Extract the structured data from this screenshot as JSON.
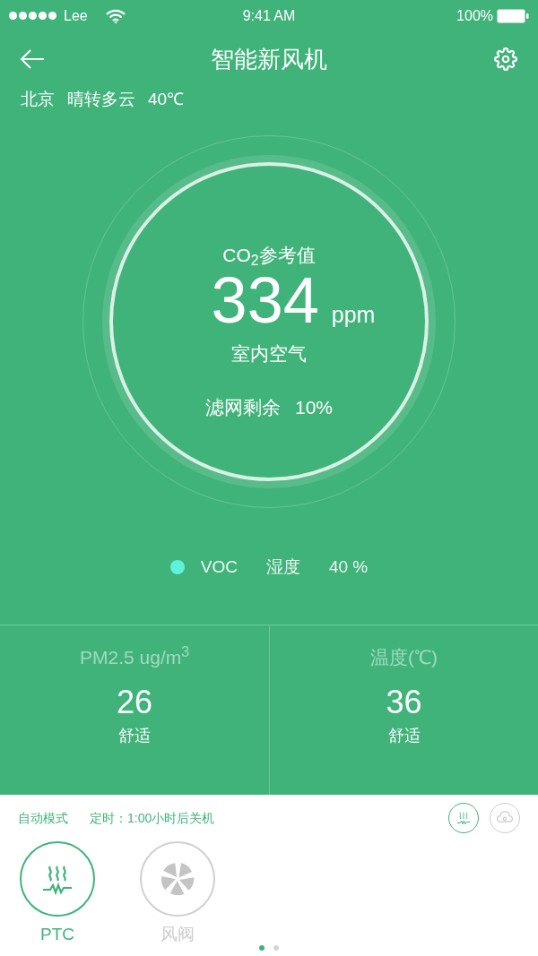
{
  "status_bar": {
    "carrier": "Lee",
    "time": "9:41 AM",
    "battery": "100%"
  },
  "header": {
    "title": "智能新风机"
  },
  "weather": [
    "北京",
    "晴转多云",
    "40℃"
  ],
  "gauge": {
    "label": "CO$_{2}$参考值",
    "value": "334",
    "unit": "ppm",
    "sublabel": "室内空气",
    "filter_label": "滤网剩余",
    "filter_value": "10%"
  },
  "legend": [
    {
      "kind": "dot",
      "label": "VOC",
      "color": "#5ef2d8"
    },
    {
      "kind": "text",
      "label": "湿度"
    },
    {
      "kind": "text",
      "label": "40 %"
    }
  ],
  "stats": [
    {
      "title": "PM2.5 ug/m$^{3}$",
      "value": "26",
      "status": "舒适"
    },
    {
      "title": "温度(℃)",
      "value": "36",
      "status": "舒适"
    }
  ],
  "controls": {
    "mode": "自动模式",
    "timer": "定时：1:00小时后关机",
    "toggles": [
      {
        "kind": "heater",
        "on": true
      },
      {
        "kind": "cloud",
        "on": false
      }
    ],
    "modes": [
      {
        "kind": "heater",
        "label": "PTC",
        "selected": true
      },
      {
        "kind": "fan",
        "label": "风阀",
        "selected": false
      }
    ],
    "pages": [
      {
        "selected": true
      },
      {
        "selected": false
      }
    ]
  }
}
